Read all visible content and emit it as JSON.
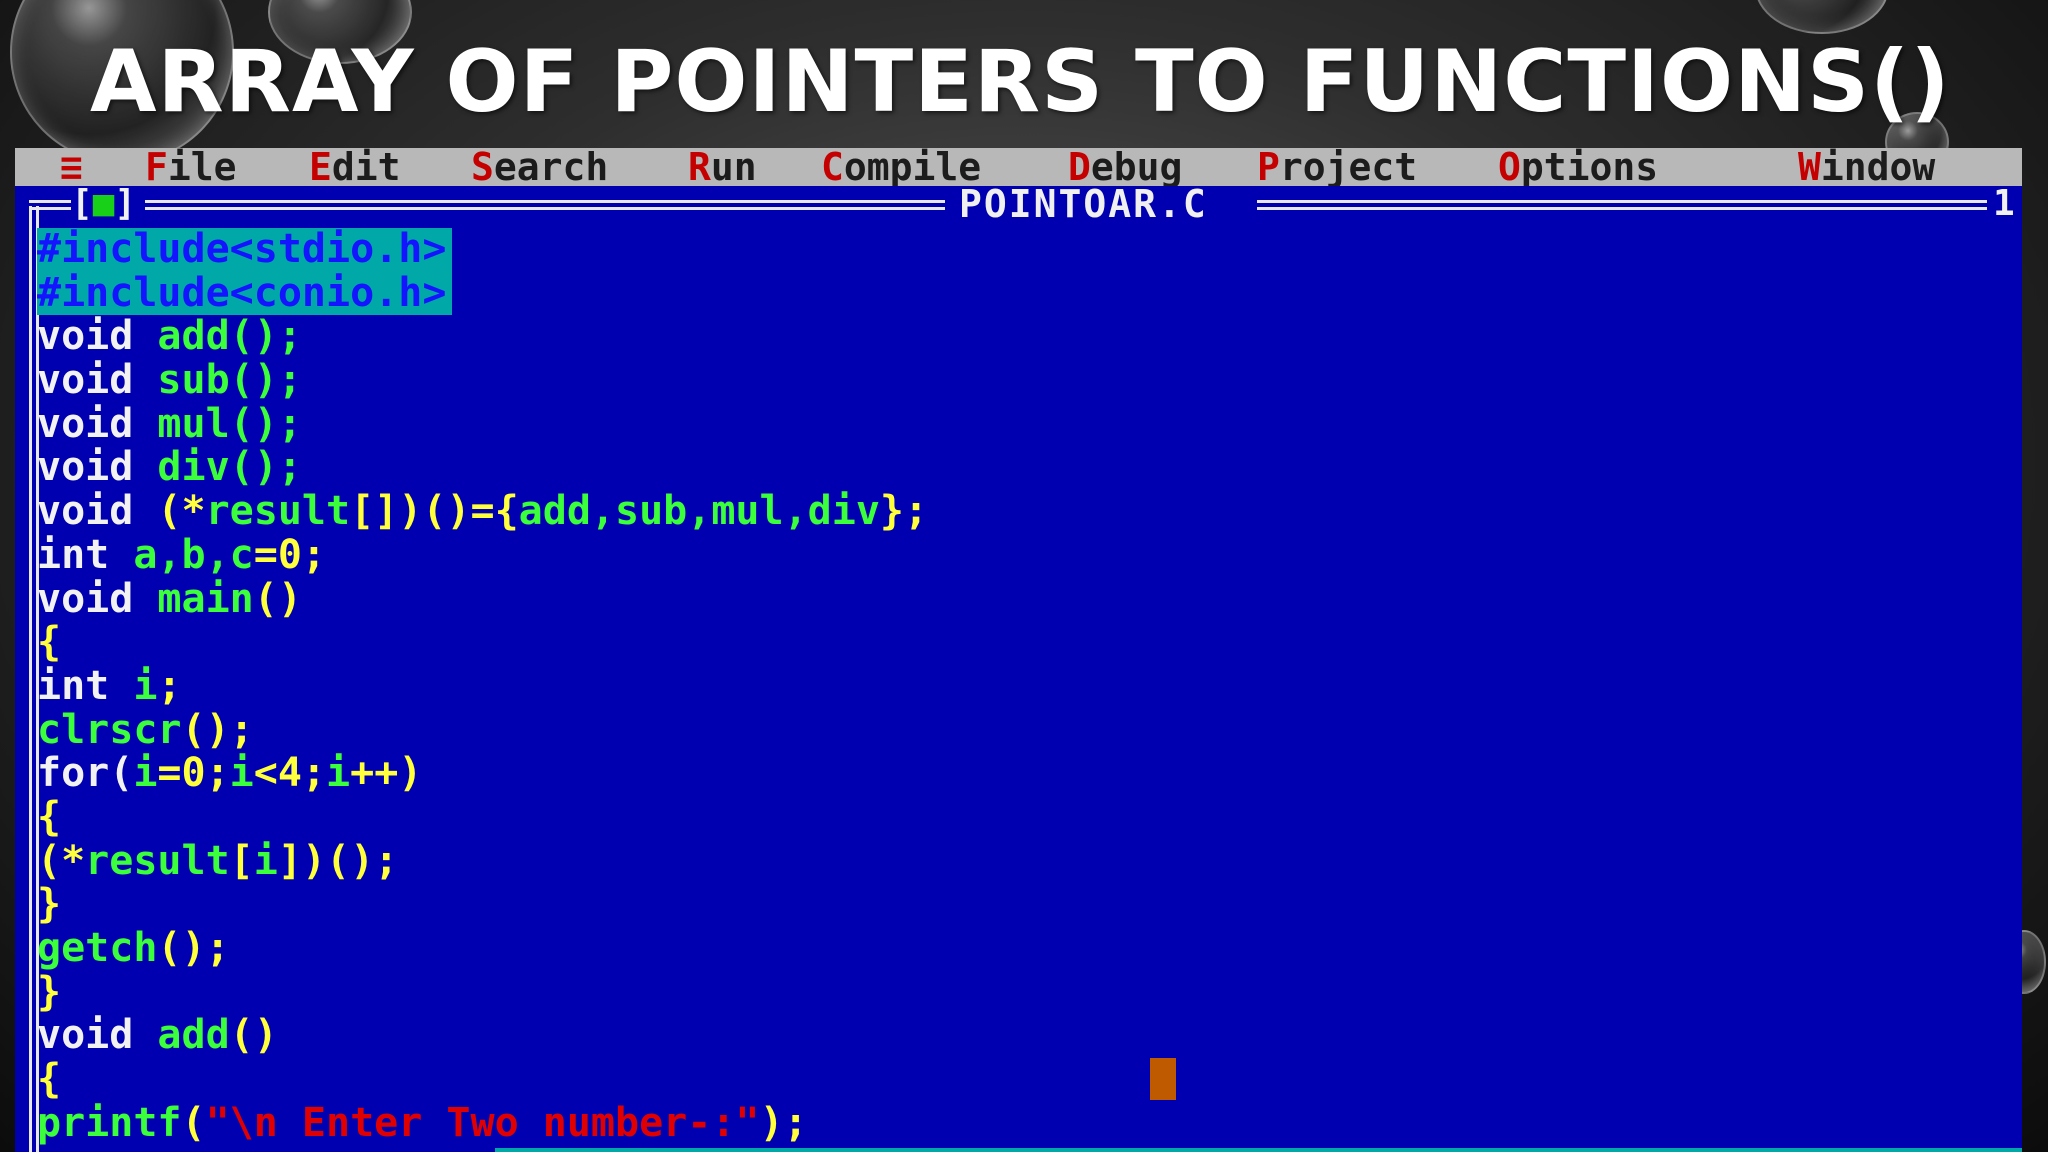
{
  "slide": {
    "title": "ARRAY OF POINTERS TO FUNCTIONS()"
  },
  "menubar": {
    "system_icon": "≡",
    "items": [
      {
        "hot": "F",
        "rest": "ile"
      },
      {
        "hot": "E",
        "rest": "dit"
      },
      {
        "hot": "S",
        "rest": "earch"
      },
      {
        "hot": "R",
        "rest": "un"
      },
      {
        "hot": "C",
        "rest": "ompile"
      },
      {
        "hot": "D",
        "rest": "ebug"
      },
      {
        "hot": "P",
        "rest": "roject"
      },
      {
        "hot": "O",
        "rest": "ptions"
      },
      {
        "hot": "W",
        "rest": "indow"
      }
    ]
  },
  "editor": {
    "close_box_open": "[",
    "close_box_dot": "■",
    "close_box_close": "]",
    "file_name": "POINTOAR.C",
    "window_number": "1"
  },
  "code": {
    "l1": "#include<stdio.h>",
    "l2": "#include<conio.h>",
    "l3a": "void ",
    "l3b": "add();",
    "l4a": "void ",
    "l4b": "sub();",
    "l5a": "void ",
    "l5b": "mul();",
    "l6a": "void ",
    "l6b": "div();",
    "l7a": "void ",
    "l7b": "(*",
    "l7c": "result",
    "l7d": "[])()={",
    "l7e": "add,sub,mul,div",
    "l7f": "};",
    "l8a": "int ",
    "l8b": "a,b,c",
    "l8c": "=0;",
    "l9a": "void ",
    "l9b": "main",
    "l9c": "()",
    "l10": "{",
    "l11a": "int ",
    "l11b": "i",
    "l11c": ";",
    "l12a": "clrscr",
    "l12b": "();",
    "l13a": "for(",
    "l13b": "i",
    "l13c": "=0;",
    "l13d": "i",
    "l13e": "<4;",
    "l13f": "i",
    "l13g": "++)",
    "l14": "{",
    "l15a": "(*",
    "l15b": "result",
    "l15c": "[",
    "l15d": "i",
    "l15e": "])();",
    "l16": "}",
    "l17a": "getch",
    "l17b": "();",
    "l18": "}",
    "l19a": "void ",
    "l19b": "add",
    "l19c": "()",
    "l20": "{",
    "l21a": "printf",
    "l21b": "(",
    "l21c": "\"\\n Enter Two number-:\"",
    "l21d": ");"
  }
}
